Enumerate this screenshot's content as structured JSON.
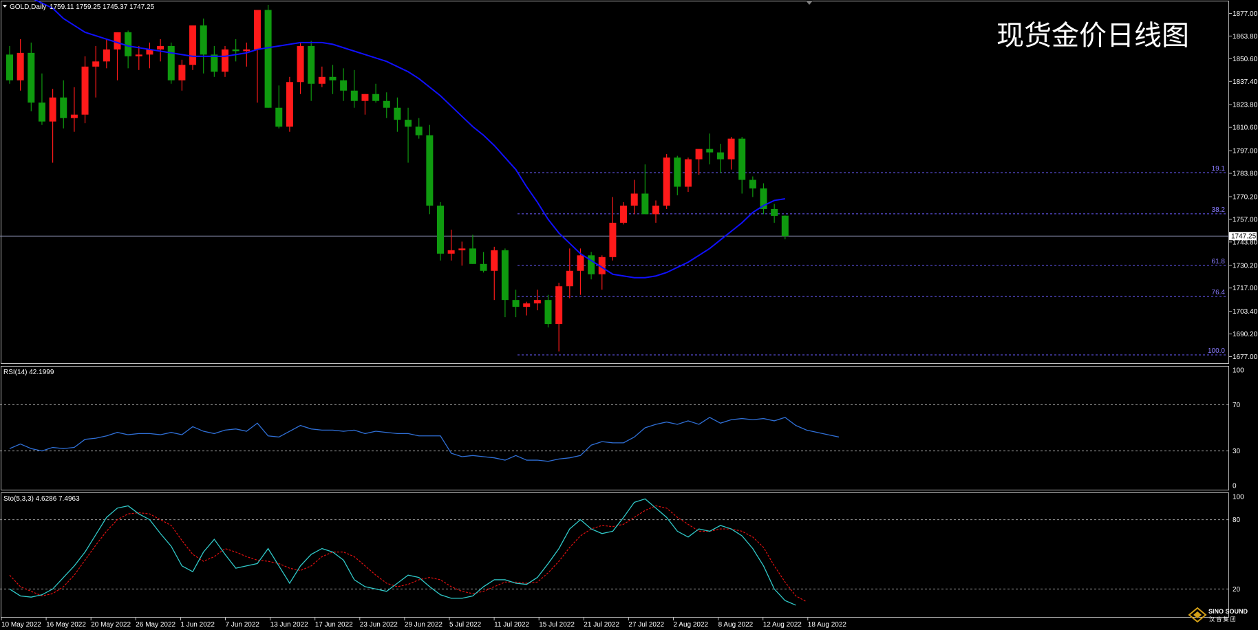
{
  "header": {
    "symbol_label": "GOLD,Daily",
    "ohlc_label": "1759.11 1759.25 1745.37 1747.25",
    "watermark_title": "现货金价日线图"
  },
  "brand": {
    "name": "SINO SOUND",
    "sub": "汉 音 集 团"
  },
  "colors": {
    "background": "#000000",
    "bull": "#ff1a1a",
    "bear": "#0f9a0f",
    "ma_line": "#1010ff",
    "rsi_line": "#2f6fd6",
    "sto_main": "#30c8c8",
    "sto_signal": "#e01010",
    "fib_line": "#6a5cff",
    "grid_dash": "#9a9a9a"
  },
  "chart_data": [
    {
      "type": "candlestick",
      "price_axis": {
        "ticks": [
          "1877.00",
          "1863.80",
          "1850.60",
          "1837.40",
          "1823.80",
          "1810.60",
          "1797.00",
          "1783.80",
          "1770.20",
          "1757.00",
          "1743.80",
          "1730.20",
          "1717.00",
          "1703.40",
          "1690.20",
          "1677.00"
        ],
        "tick_values": [
          1877.0,
          1863.8,
          1850.6,
          1837.4,
          1823.8,
          1810.6,
          1797.0,
          1783.8,
          1770.2,
          1757.0,
          1743.8,
          1730.2,
          1717.0,
          1703.4,
          1690.2,
          1677.0
        ],
        "range": [
          1673.2,
          1884.0
        ],
        "current_price": 1747.25,
        "current_label": "1747.25"
      },
      "date_labels": [
        "10 May 2022",
        "16 May 2022",
        "20 May 2022",
        "26 May 2022",
        "1 Jun 2022",
        "7 Jun 2022",
        "13 Jun 2022",
        "17 Jun 2022",
        "23 Jun 2022",
        "29 Jun 2022",
        "5 Jul 2022",
        "11 Jul 2022",
        "15 Jul 2022",
        "21 Jul 2022",
        "27 Jul 2022",
        "2 Aug 2022",
        "8 Aug 2022",
        "12 Aug 2022",
        "18 Aug 2022"
      ],
      "ohlc": [
        [
          1853.0,
          1858.0,
          1836.0,
          1838.0
        ],
        [
          1838.0,
          1862.0,
          1832.0,
          1854.0
        ],
        [
          1854.0,
          1860.0,
          1820.0,
          1825.0
        ],
        [
          1825.0,
          1842.0,
          1812.0,
          1814.0
        ],
        [
          1814.0,
          1833.0,
          1790.0,
          1828.0
        ],
        [
          1828.0,
          1838.0,
          1810.0,
          1816.0
        ],
        [
          1816.0,
          1834.0,
          1808.0,
          1818.0
        ],
        [
          1818.0,
          1852.0,
          1813.0,
          1846.0
        ],
        [
          1846.0,
          1858.0,
          1828.0,
          1849.0
        ],
        [
          1849.0,
          1862.0,
          1845.0,
          1856.0
        ],
        [
          1856.0,
          1866.0,
          1838.0,
          1866.0
        ],
        [
          1866.0,
          1867.0,
          1845.0,
          1852.0
        ],
        [
          1852.0,
          1858.0,
          1844.0,
          1853.0
        ],
        [
          1853.0,
          1860.0,
          1845.0,
          1856.0
        ],
        [
          1856.0,
          1862.0,
          1849.0,
          1858.0
        ],
        [
          1858.0,
          1860.0,
          1836.0,
          1838.0
        ],
        [
          1838.0,
          1850.0,
          1832.0,
          1847.0
        ],
        [
          1847.0,
          1870.0,
          1844.0,
          1870.0
        ],
        [
          1870.0,
          1874.0,
          1842.0,
          1853.0
        ],
        [
          1853.0,
          1858.0,
          1840.0,
          1843.0
        ],
        [
          1843.0,
          1858.0,
          1840.0,
          1856.0
        ],
        [
          1856.0,
          1862.0,
          1849.0,
          1855.0
        ],
        [
          1855.0,
          1860.0,
          1846.0,
          1856.0
        ],
        [
          1856.0,
          1878.0,
          1825.0,
          1879.0
        ],
        [
          1879.0,
          1882.0,
          1822.0,
          1822.0
        ],
        [
          1822.0,
          1835.0,
          1810.0,
          1811.0
        ],
        [
          1811.0,
          1840.0,
          1808.0,
          1837.0
        ],
        [
          1837.0,
          1860.0,
          1830.0,
          1858.0
        ],
        [
          1858.0,
          1861.0,
          1826.0,
          1836.0
        ],
        [
          1836.0,
          1846.0,
          1834.0,
          1840.0
        ],
        [
          1840.0,
          1847.0,
          1830.0,
          1838.0
        ],
        [
          1838.0,
          1845.0,
          1826.0,
          1832.0
        ],
        [
          1832.0,
          1844.0,
          1822.0,
          1826.0
        ],
        [
          1826.0,
          1830.0,
          1818.0,
          1830.0
        ],
        [
          1830.0,
          1836.0,
          1825.0,
          1826.0
        ],
        [
          1826.0,
          1831.0,
          1816.0,
          1822.0
        ],
        [
          1822.0,
          1828.0,
          1808.0,
          1815.0
        ],
        [
          1815.0,
          1822.0,
          1790.0,
          1811.0
        ],
        [
          1811.0,
          1816.0,
          1804.0,
          1806.0
        ],
        [
          1806.0,
          1812.0,
          1760.0,
          1765.0
        ],
        [
          1765.0,
          1767.0,
          1733.0,
          1737.0
        ],
        [
          1737.0,
          1751.0,
          1733.0,
          1739.0
        ],
        [
          1739.0,
          1744.0,
          1730.0,
          1740.0
        ],
        [
          1740.0,
          1748.0,
          1731.0,
          1731.0
        ],
        [
          1731.0,
          1738.0,
          1726.0,
          1727.0
        ],
        [
          1727.0,
          1741.0,
          1710.0,
          1739.0
        ],
        [
          1739.0,
          1740.0,
          1700.0,
          1710.0
        ],
        [
          1710.0,
          1716.0,
          1700.0,
          1706.0
        ],
        [
          1706.0,
          1709.0,
          1701.0,
          1708.0
        ],
        [
          1708.0,
          1716.0,
          1704.0,
          1710.0
        ],
        [
          1710.0,
          1713.0,
          1694.0,
          1696.0
        ],
        [
          1696.0,
          1720.0,
          1680.0,
          1718.0
        ],
        [
          1718.0,
          1740.0,
          1711.0,
          1727.0
        ],
        [
          1727.0,
          1740.0,
          1713.0,
          1736.0
        ],
        [
          1736.0,
          1738.0,
          1722.0,
          1725.0
        ],
        [
          1725.0,
          1736.0,
          1716.0,
          1735.0
        ],
        [
          1735.0,
          1770.0,
          1733.0,
          1755.0
        ],
        [
          1755.0,
          1767.0,
          1754.0,
          1765.0
        ],
        [
          1765.0,
          1780.0,
          1760.0,
          1772.0
        ],
        [
          1772.0,
          1789.0,
          1760.0,
          1760.0
        ],
        [
          1760.0,
          1768.0,
          1755.0,
          1765.0
        ],
        [
          1765.0,
          1795.0,
          1763.0,
          1793.0
        ],
        [
          1793.0,
          1794.0,
          1771.0,
          1776.0
        ],
        [
          1776.0,
          1793.0,
          1773.0,
          1792.0
        ],
        [
          1792.0,
          1797.0,
          1783.0,
          1798.0
        ],
        [
          1798.0,
          1807.0,
          1789.0,
          1796.0
        ],
        [
          1796.0,
          1801.0,
          1784.0,
          1792.0
        ],
        [
          1792.0,
          1805.0,
          1786.0,
          1804.0
        ],
        [
          1804.0,
          1805.0,
          1772.0,
          1780.0
        ],
        [
          1780.0,
          1782.0,
          1770.0,
          1775.0
        ],
        [
          1775.0,
          1778.0,
          1760.0,
          1763.0
        ],
        [
          1763.0,
          1766.0,
          1755.0,
          1759.0
        ],
        [
          1759.11,
          1759.25,
          1745.37,
          1747.25
        ]
      ],
      "ma_values": [
        1893,
        1890,
        1886,
        1883,
        1880,
        1874,
        1870,
        1866,
        1864,
        1862,
        1860,
        1858,
        1857,
        1856,
        1855,
        1854,
        1853,
        1852,
        1852,
        1852,
        1852,
        1853,
        1854,
        1856,
        1857,
        1858,
        1859,
        1860,
        1860,
        1860,
        1859,
        1857,
        1855,
        1853,
        1851,
        1849,
        1846,
        1843,
        1839,
        1834,
        1829,
        1823,
        1817,
        1811,
        1806,
        1800,
        1793,
        1786,
        1776,
        1767,
        1757,
        1749,
        1743,
        1737,
        1733,
        1729,
        1725,
        1724,
        1723,
        1723,
        1724,
        1726,
        1729,
        1732,
        1736,
        1740,
        1745,
        1750,
        1755,
        1761,
        1765,
        1768,
        1769
      ],
      "fib_levels": [
        {
          "label": "19.1",
          "value": 1784.2
        },
        {
          "label": "38.2",
          "value": 1760.2
        },
        {
          "label": "61.8",
          "value": 1730.2
        },
        {
          "label": "76.4",
          "value": 1712.0
        },
        {
          "label": "100.0",
          "value": 1678.0
        }
      ]
    },
    {
      "type": "line",
      "label": "RSI(14) 42.1999",
      "ticks": [
        "100",
        "70",
        "30",
        "0"
      ],
      "tick_values": [
        100,
        70,
        30,
        0
      ],
      "ylim": [
        0,
        100
      ],
      "levels": [
        70,
        30
      ],
      "values": [
        32,
        36,
        32,
        30,
        33,
        32,
        33,
        40,
        41,
        43,
        46,
        44,
        45,
        45,
        44,
        46,
        44,
        51,
        47,
        45,
        48,
        49,
        47,
        54,
        43,
        42,
        47,
        52,
        49,
        48,
        48,
        47,
        48,
        45,
        47,
        46,
        45,
        45,
        43,
        43,
        43,
        28,
        25,
        26,
        25,
        24,
        22,
        26,
        22,
        22,
        21,
        23,
        24,
        26,
        35,
        38,
        37,
        37,
        42,
        50,
        53,
        55,
        53,
        56,
        53,
        59,
        54,
        57,
        58,
        57,
        58,
        56,
        59,
        52,
        48,
        46,
        44,
        42
      ]
    },
    {
      "type": "line",
      "label": "Sto(5,3,3) 4.6286 7.4963",
      "ticks": [
        "100",
        "80",
        "20"
      ],
      "tick_values": [
        100,
        80,
        20
      ],
      "ylim": [
        0,
        100
      ],
      "levels": [
        80,
        20
      ],
      "main_values": [
        20,
        14,
        13,
        15,
        20,
        30,
        40,
        52,
        67,
        82,
        90,
        92,
        85,
        80,
        68,
        57,
        40,
        35,
        52,
        63,
        50,
        38,
        40,
        42,
        55,
        40,
        25,
        40,
        50,
        55,
        52,
        45,
        28,
        22,
        20,
        18,
        25,
        32,
        30,
        22,
        15,
        12,
        12,
        14,
        22,
        28,
        28,
        25,
        24,
        30,
        42,
        55,
        72,
        80,
        72,
        68,
        70,
        82,
        95,
        98,
        90,
        82,
        70,
        65,
        72,
        70,
        75,
        72,
        66,
        55,
        40,
        20,
        10,
        6
      ],
      "signal_values": [
        32,
        22,
        18,
        14,
        16,
        22,
        32,
        45,
        58,
        70,
        80,
        85,
        86,
        85,
        80,
        75,
        62,
        50,
        44,
        48,
        55,
        52,
        48,
        45,
        44,
        42,
        38,
        36,
        40,
        48,
        52,
        52,
        48,
        40,
        32,
        25,
        22,
        24,
        28,
        30,
        28,
        22,
        18,
        16,
        18,
        22,
        26,
        26,
        25,
        26,
        34,
        44,
        56,
        66,
        72,
        75,
        74,
        76,
        82,
        88,
        92,
        90,
        82,
        76,
        70,
        70,
        72,
        72,
        70,
        65,
        56,
        40,
        26,
        14,
        9
      ]
    }
  ]
}
